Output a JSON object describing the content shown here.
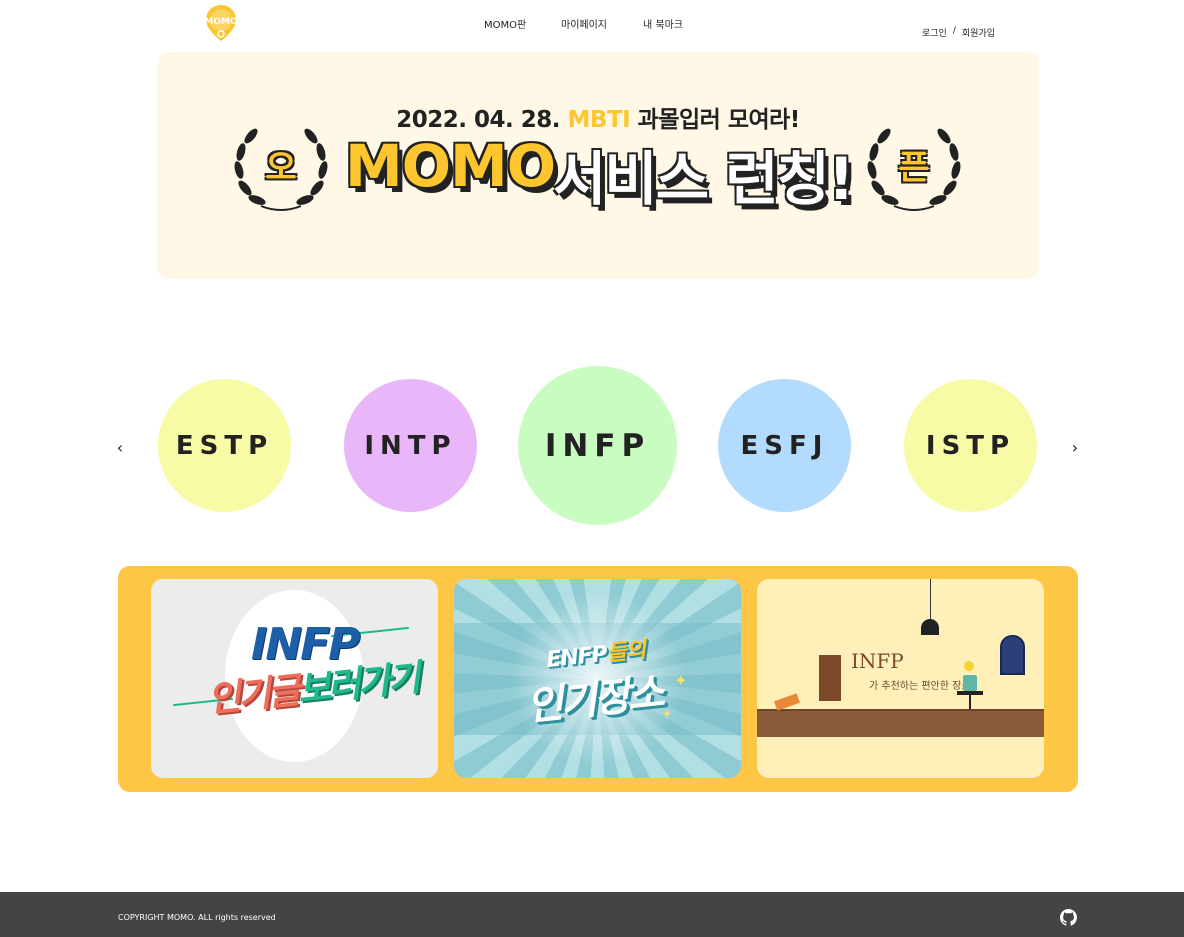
{
  "header": {
    "logo_text": "MOMO",
    "nav": [
      "MOMO판",
      "마이페이지",
      "내 북마크"
    ],
    "login": "로그인",
    "separator": "/",
    "signup": "회원가입"
  },
  "banner": {
    "date": "2022. 04. 28.",
    "mbti": "MBTI",
    "tagline": "과몰입러 모여라!",
    "brand": "MOMO",
    "launch": "서비스 런칭!",
    "left_badge": "오",
    "right_badge": "픈",
    "background": "#fff8e7",
    "accent": "#fdc52e"
  },
  "carousel": {
    "prev_icon": "chevron-left-icon",
    "next_icon": "chevron-right-icon",
    "items": [
      {
        "label": "ESTP",
        "color": "#f8fba6"
      },
      {
        "label": "INTP",
        "color": "#e8b6f9"
      },
      {
        "label": "INFP",
        "color": "#c9fcc0"
      },
      {
        "label": "ESFJ",
        "color": "#b3dbfd"
      },
      {
        "label": "ISTP",
        "color": "#f8fba6"
      }
    ],
    "active_index": 2
  },
  "cards": {
    "background": "#fdc645",
    "items": [
      {
        "title_main": "INFP",
        "title_sub_a": "인기글",
        "title_sub_b": "보러가기"
      },
      {
        "title_main_a": "ENFP",
        "title_main_b": "들의",
        "title_sub": "인기장소"
      },
      {
        "title_main": "INFP",
        "title_sub": "가 추천하는 편안한 장소"
      }
    ]
  },
  "footer": {
    "copyright": "COPYRIGHT MOMO. ALL rights reserved",
    "github_icon": "github-icon",
    "background": "#444444"
  }
}
